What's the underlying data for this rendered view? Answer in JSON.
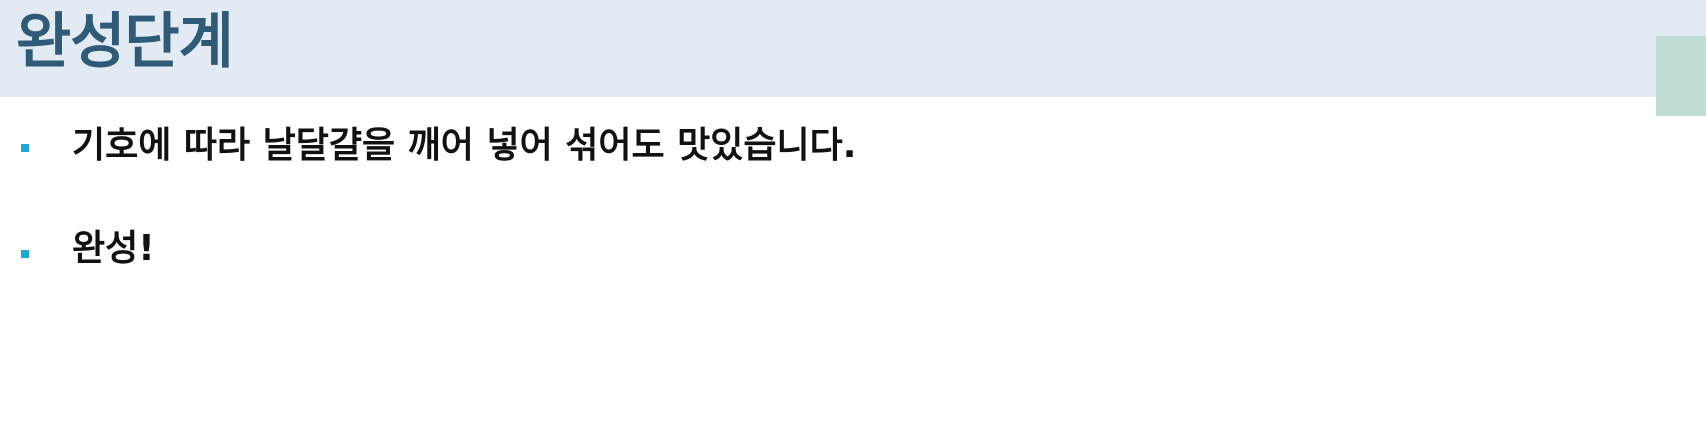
{
  "slide": {
    "title": "완성단계",
    "bullets": [
      {
        "text": "기호에 따라 날달걀을 깨어 넣어 섞어도 맛있습니다."
      },
      {
        "text": "완성!"
      }
    ]
  },
  "colors": {
    "title": "#2f5b78",
    "header_background": "#e2ebf3",
    "bullet_marker": "#1ea7d8",
    "corner_accent": "#c0ddd5",
    "body_text": "#111111"
  }
}
